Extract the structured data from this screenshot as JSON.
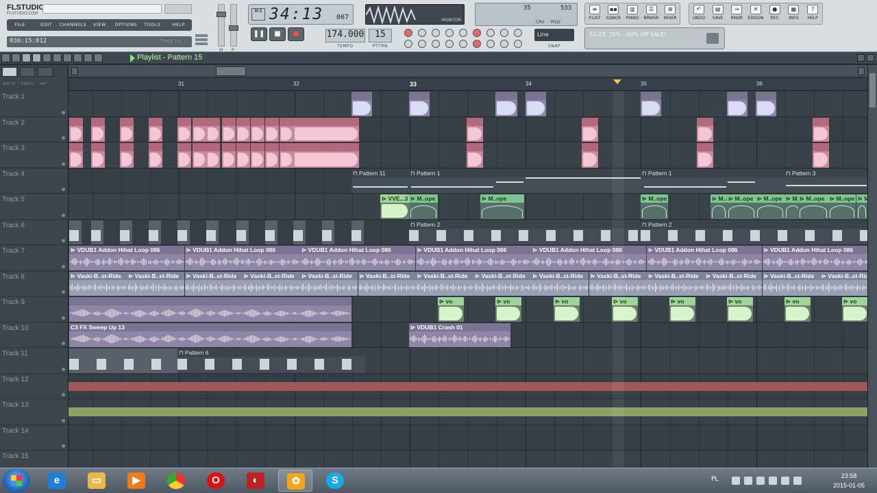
{
  "app": {
    "logo": "FLSTUDIO",
    "logo_sub": "FLSTUDIO.COM",
    "hint_track": "Track 14",
    "menu": [
      "FILE",
      "EDIT",
      "CHANNELS",
      "VIEW",
      "OPTIONS",
      "TOOLS",
      "HELP"
    ],
    "time_readout": "036:15:012",
    "song_position": "34:13",
    "song_position_ticks": "007",
    "tempo": "174.000",
    "tempo_label": "TEMPO",
    "pattern_number": "15",
    "pattern_label": "PTTRN",
    "monitor_label": "MONITOR",
    "cpu_value": "35",
    "poly_value": "533",
    "cpu_label": "CPU",
    "poly_label": "POLY",
    "snap_value": "Line",
    "snap_label": "SNAP",
    "news_text": "12-23: 25% - 50% Off SALE!",
    "slider_labels": [
      "M",
      "P"
    ],
    "panel_buttons": [
      {
        "label": "P.LIST",
        "icon": "playlist-icon"
      },
      {
        "label": "SQNCR",
        "icon": "sequencer-icon"
      },
      {
        "label": "PIANO",
        "icon": "piano-icon"
      },
      {
        "label": "BRWSR",
        "icon": "browser-icon"
      },
      {
        "label": "MIXER",
        "icon": "mixer-icon"
      }
    ],
    "tool_buttons": [
      {
        "label": "UNDO",
        "glyph": "↶"
      },
      {
        "label": "SAVE",
        "glyph": "▤"
      },
      {
        "label": "RNDR",
        "glyph": "→"
      },
      {
        "label": "EDISON",
        "glyph": "✕"
      },
      {
        "label": "REC",
        "glyph": "●"
      },
      {
        "label": "INFO",
        "glyph": "▦"
      },
      {
        "label": "HELP",
        "glyph": "?"
      }
    ]
  },
  "playlist": {
    "title": "Playlist - Pattern 15",
    "left_sub": "NOTE · UNDO · PAT",
    "bars": [
      "31",
      "32",
      "33",
      "34",
      "35",
      "36"
    ],
    "tracks": [
      "Track 1",
      "Track 2",
      "Track 3",
      "Track 4",
      "Track 5",
      "Track 6",
      "Track 7",
      "Track 8",
      "Track 9",
      "Track 10",
      "Track 11",
      "Track 12",
      "Track 13",
      "Track 14",
      "Track 15"
    ],
    "clip_names": {
      "pattern_11": "Pattern 11",
      "pattern_1": "Pattern 1",
      "pattern_3": "Pattern 3",
      "pattern_2": "Pattern 2",
      "pattern_6": "Pattern 6",
      "hihat": "VDUB1 Addon Hihat Loop 086",
      "ride": "Vaski-B..st-Ride",
      "sweep": "C3 FX Sweep Up 13",
      "crash": "VDUB1 Crash 01",
      "vo": "vo",
      "mope": "M..ope",
      "vve": "VVE...3"
    }
  },
  "taskbar": {
    "apps": [
      "ie-icon",
      "explorer-icon",
      "media-icon",
      "chrome-icon",
      "opera-icon",
      "app-icon",
      "flstudio-icon",
      "skype-icon"
    ],
    "language": "PL",
    "time": "23:58",
    "date": "2015-01-05"
  }
}
